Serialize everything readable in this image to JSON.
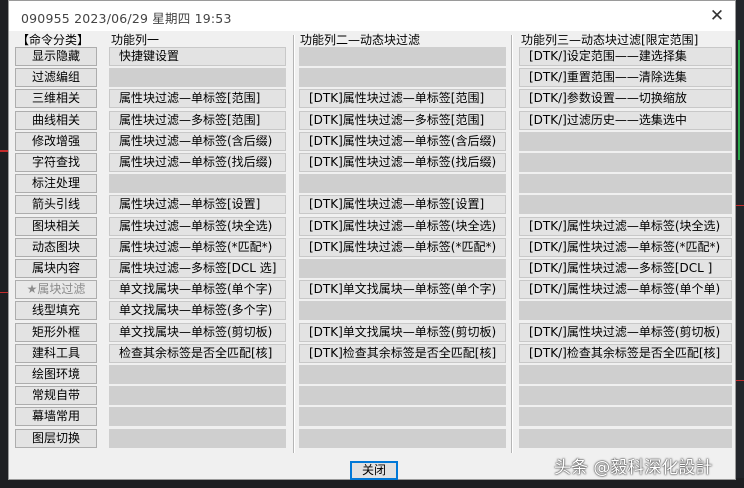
{
  "window": {
    "title": "090955 2023/06/29 星期四 19:53",
    "close_glyph": "✕"
  },
  "headers": {
    "categories": "【命令分类】",
    "col1": "功能列一",
    "col2": "功能列二—动态块过滤",
    "col3": "功能列三—动态块过滤[限定范围]"
  },
  "categories": [
    {
      "label": "显示隐藏"
    },
    {
      "label": "过滤编组"
    },
    {
      "label": "三维相关"
    },
    {
      "label": "曲线相关"
    },
    {
      "label": "修改增强"
    },
    {
      "label": "字符查找"
    },
    {
      "label": "标注处理"
    },
    {
      "label": "箭头引线"
    },
    {
      "label": "图块相关"
    },
    {
      "label": "动态图块"
    },
    {
      "label": "属块内容"
    },
    {
      "label": "★属块过滤",
      "active": true
    },
    {
      "label": "线型填充"
    },
    {
      "label": "矩形外框"
    },
    {
      "label": "建科工具"
    },
    {
      "label": "绘图环境"
    },
    {
      "label": "常规自带"
    },
    {
      "label": "幕墙常用"
    },
    {
      "label": "图层切换"
    }
  ],
  "col1": [
    "快捷键设置",
    "",
    "属性块过滤—单标签[范围]",
    "属性块过滤—多标签[范围]",
    "属性块过滤—单标签(含后缀)",
    "属性块过滤—单标签(找后缀)",
    "",
    "属性块过滤—单标签[设置]",
    "属性块过滤—单标签(块全选)",
    "属性块过滤—单标签(*匹配*)",
    "属性块过滤—多标签[DCL 选]",
    "单文找属块—单标签(单个字)",
    "单文找属块—单标签(多个字)",
    "单文找属块—单标签(剪切板)",
    "检查其余标签是否全匹配[核]",
    "",
    "",
    "",
    ""
  ],
  "col2": [
    "",
    "",
    "[DTK]属性块过滤—单标签[范围]",
    "[DTK]属性块过滤—多标签[范围]",
    "[DTK]属性块过滤—单标签(含后缀)",
    "[DTK]属性块过滤—单标签(找后缀)",
    "",
    "[DTK]属性块过滤—单标签[设置]",
    "[DTK]属性块过滤—单标签(块全选)",
    "[DTK]属性块过滤—单标签(*匹配*)",
    "",
    "[DTK]单文找属块—单标签(单个字)",
    "",
    "[DTK]单文找属块—单标签(剪切板)",
    "[DTK]检查其余标签是否全匹配[核]",
    "",
    "",
    "",
    ""
  ],
  "col3": [
    "[DTK/]设定范围——建选择集",
    "[DTK/]重置范围——清除选集",
    "[DTK/]参数设置——切换缩放",
    "[DTK/]过滤历史——选集选中",
    "",
    "",
    "",
    "",
    "[DTK/]属性块过滤—单标签(块全选)",
    "[DTK/]属性块过滤—单标签(*匹配*)",
    "[DTK/]属性块过滤—多标签[DCL ]",
    "[DTK/]属性块过滤—单标签(单个单)",
    "",
    "[DTK/]属性块过滤—单标签(剪切板)",
    "[DTK/]检查其余标签是否全匹配[核]",
    "",
    "",
    "",
    ""
  ],
  "footer": {
    "close_label": "关闭"
  },
  "watermark": "头条 @毅科深化設計",
  "colors": {
    "dialog_bg": "#f0f0f0",
    "button_bg": "#e3e3e3",
    "empty_slot": "#cfcfcf",
    "focus_border": "#0078d7",
    "disabled_text": "#8c8c8c"
  }
}
